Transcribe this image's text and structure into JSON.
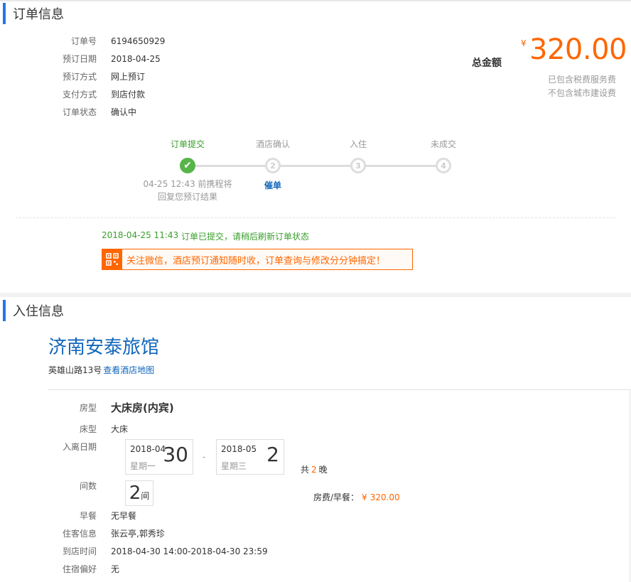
{
  "order": {
    "section_title": "订单信息",
    "fields": [
      {
        "label": "订单号",
        "value": "6194650929"
      },
      {
        "label": "预订日期",
        "value": "2018-04-25"
      },
      {
        "label": "预订方式",
        "value": "网上预订"
      },
      {
        "label": "支付方式",
        "value": "到店付款"
      },
      {
        "label": "订单状态",
        "value": "确认中"
      }
    ],
    "total_label": "总金额",
    "currency": "¥",
    "total_amount": "320.00",
    "notes": [
      "已包含税费服务费",
      "不包含城市建设费"
    ],
    "steps": [
      {
        "label": "订单提交",
        "marker": "✔",
        "status": "done"
      },
      {
        "label": "酒店确认",
        "marker": "2",
        "status": "pending"
      },
      {
        "label": "入住",
        "marker": "3",
        "status": "pending"
      },
      {
        "label": "未成交",
        "marker": "4",
        "status": "pending"
      }
    ],
    "step1_note_line1": "04-25 12:43 前携程将",
    "step1_note_line2": "回复您预订结果",
    "step2_link": "催单",
    "log_time": "2018-04-25 11:43",
    "log_message": "订单已提交，请稍后刷新订单状态",
    "wechat_banner": "关注微信，酒店预订通知随时收，订单查询与修改分分钟搞定！"
  },
  "stay": {
    "section_title": "入住信息",
    "hotel_name": "济南安泰旅馆",
    "address": "英雄山路13号",
    "map_link": "查看酒店地图",
    "room_type_label": "房型",
    "room_type": "大床房(内宾)",
    "bed_label": "床型",
    "bed": "大床",
    "dates_label": "入离日期",
    "checkin": {
      "ym": "2018-04",
      "day": "30",
      "weekday": "星期一"
    },
    "checkout": {
      "ym": "2018-05",
      "day": "2",
      "weekday": "星期三"
    },
    "date_separator": "-",
    "nights_prefix": "共",
    "nights": "2",
    "nights_suffix": "晚",
    "rooms_label": "间数",
    "rooms": "2",
    "rooms_unit": "间",
    "fee_label": "房费/早餐：",
    "fee_currency": "¥",
    "fee_amount": "320.00",
    "breakfast_label": "早餐",
    "breakfast": "无早餐",
    "guests_label": "住客信息",
    "guests": "张云亭,郭秀珍",
    "arrival_label": "到店时间",
    "arrival": "2018-04-30 14:00-2018-04-30 23:59",
    "pref_label": "住宿偏好",
    "pref": "无"
  },
  "colors": {
    "accent_blue": "#2577e3",
    "link": "#1166bb",
    "price": "#ff6600",
    "success": "#3a9f2c"
  }
}
